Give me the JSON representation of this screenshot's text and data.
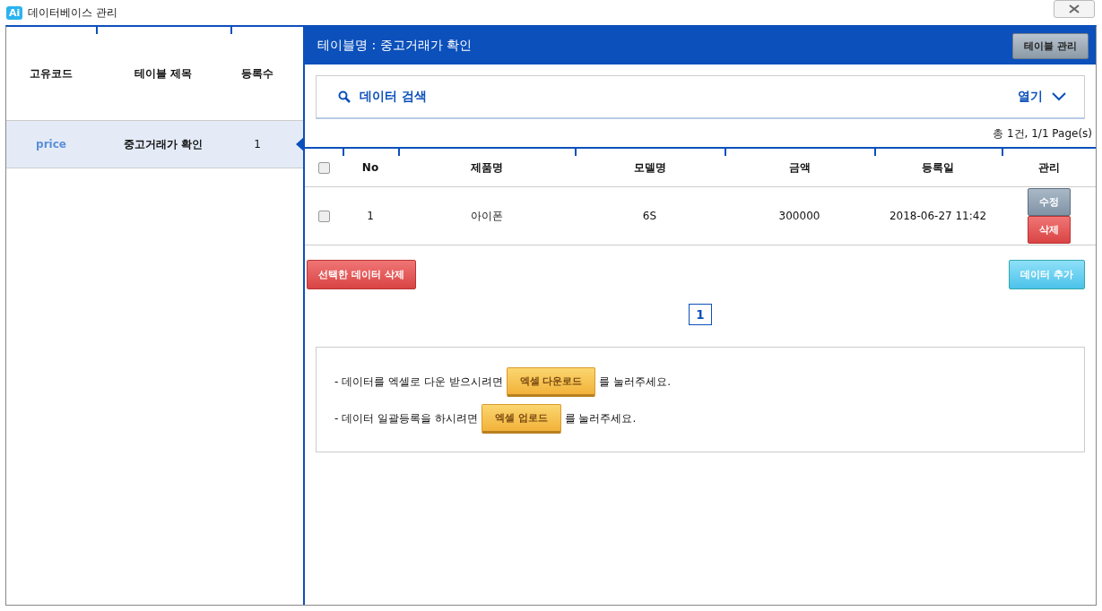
{
  "window": {
    "title": "데이터베이스 관리",
    "app_badge": "Ai"
  },
  "sidebar": {
    "columns": [
      "고유코드",
      "테이블 제목",
      "등록수"
    ],
    "rows": [
      {
        "code": "price",
        "title": "중고거래가 확인",
        "count": "1",
        "selected": true
      }
    ]
  },
  "main": {
    "title": "테이블명 : 중고거래가 확인",
    "manage_button": "테이블 관리",
    "search": {
      "label": "데이터 검색",
      "toggle": "열기",
      "expanded": false
    },
    "summary": "총 1건, 1/1 Page(s)",
    "table": {
      "columns": [
        "No",
        "제품명",
        "모델명",
        "금액",
        "등록일",
        "관리"
      ],
      "all_checked": false,
      "rows": [
        {
          "checked": false,
          "cells": [
            "1",
            "아이폰",
            "6S",
            "300000",
            "2018-06-27 11:42"
          ],
          "edit": "수정",
          "delete": "삭제"
        }
      ]
    },
    "delete_selected": "선택한 데이터 삭제",
    "add": "데이터 추가",
    "pages": [
      {
        "label": "1",
        "selected": true
      }
    ],
    "instructions": [
      {
        "before": "- 데이터를 엑셀로 다운 받으시려면",
        "button": "엑셀 다운로드",
        "after": "를 눌러주세요."
      },
      {
        "before": "- 데이터 일괄등록을 하시려면",
        "button": "엑셀 업로드",
        "after": "를 눌러주세요."
      }
    ]
  }
}
